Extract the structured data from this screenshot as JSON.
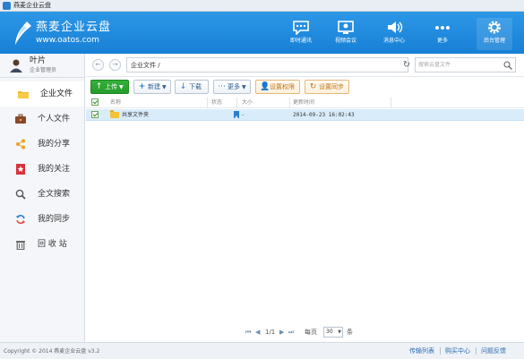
{
  "window": {
    "title": "燕麦企业云盘"
  },
  "brand": {
    "name": "燕麦企业云盘",
    "url": "www.oatos.com"
  },
  "header_buttons": [
    {
      "label": "即时通讯",
      "icon": "chat-icon"
    },
    {
      "label": "视频会议",
      "icon": "video-meeting-icon"
    },
    {
      "label": "消息中心",
      "icon": "speaker-icon"
    },
    {
      "label": "更多",
      "icon": "more-icon"
    },
    {
      "label": "后台管理",
      "icon": "gear-icon"
    }
  ],
  "user": {
    "name": "叶片",
    "role": "企业管理员"
  },
  "sidebar": {
    "items": [
      {
        "label": "企业文件",
        "icon": "folder-icon",
        "active": true
      },
      {
        "label": "个人文件",
        "icon": "briefcase-icon"
      },
      {
        "label": "我的分享",
        "icon": "share-icon"
      },
      {
        "label": "我的关注",
        "icon": "star-bookmark-icon"
      },
      {
        "label": "全文搜索",
        "icon": "search-icon"
      },
      {
        "label": "我的同步",
        "icon": "sync-icon"
      },
      {
        "label": "回 收 站",
        "icon": "trash-icon"
      }
    ]
  },
  "pathbar": {
    "path": "企业文件 /",
    "search_placeholder": "搜索云盘文件"
  },
  "toolbar": {
    "upload": "上传",
    "new": "新建",
    "download": "下载",
    "more": "更多",
    "permissions": "设置权限",
    "sync": "设置同步"
  },
  "table": {
    "columns": [
      "名称",
      "状态",
      "大小",
      "更新时间"
    ],
    "rows": [
      {
        "name": "共享文件夹",
        "size": "-",
        "updated": "2014-09-23 16:02:43"
      }
    ]
  },
  "pager": {
    "page_info": "1/1",
    "per_page_label": "每页",
    "per_page_value": "30",
    "unit": "条"
  },
  "status": {
    "copyright": "Copyright © 2014 燕麦企业云盘 v3.2",
    "links": [
      "传输列表",
      "购买中心",
      "问题反馈"
    ]
  },
  "colors": {
    "header_blue": "#1780d6",
    "upload_green": "#249c2b",
    "selected_row": "#d9ecfa",
    "folder_yellow": "#f3c238"
  }
}
